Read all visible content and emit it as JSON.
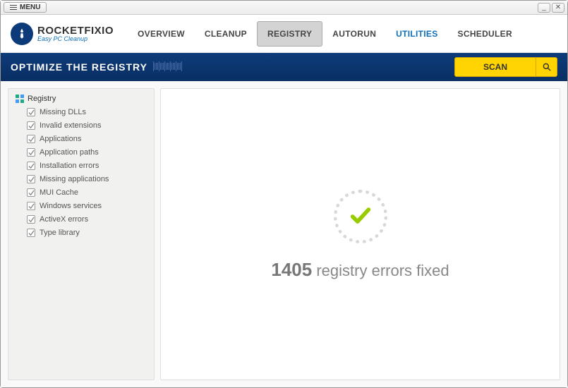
{
  "menu": {
    "label": "MENU"
  },
  "logo": {
    "title": "ROCKETFIXIO",
    "subtitle": "Easy PC Cleanup"
  },
  "tabs": {
    "overview": "OVERVIEW",
    "cleanup": "CLEANUP",
    "registry": "REGISTRY",
    "autorun": "AUTORUN",
    "utilities": "UTILITIES",
    "scheduler": "SCHEDULER"
  },
  "bluebar": {
    "title": "OPTIMIZE THE REGISTRY"
  },
  "scan": {
    "label": "SCAN"
  },
  "sidebar": {
    "root": "Registry",
    "items": [
      "Missing DLLs",
      "Invalid extensions",
      "Applications",
      "Application paths",
      "Installation errors",
      "Missing applications",
      "MUI Cache",
      "Windows services",
      "ActiveX errors",
      "Type library"
    ]
  },
  "result": {
    "count": "1405",
    "label": "registry errors fixed"
  }
}
